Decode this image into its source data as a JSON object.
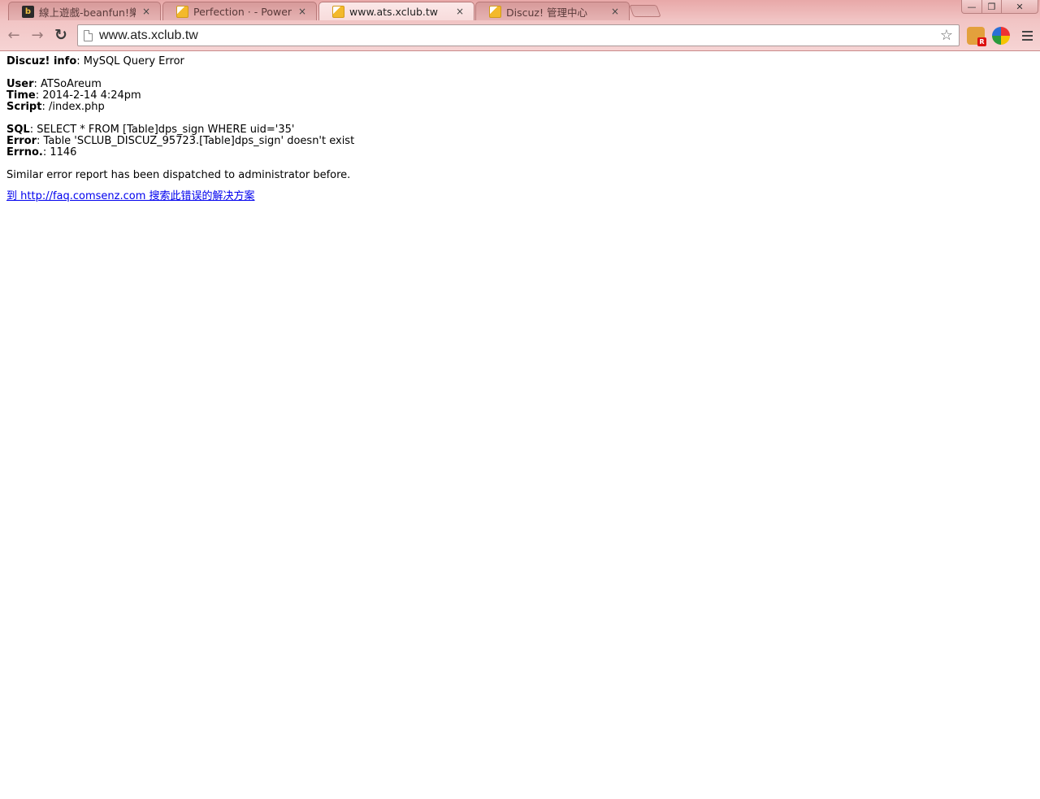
{
  "browser": {
    "tabs": [
      {
        "title": "線上遊戲-beanfun!樂豆",
        "favicon": "beanfun-icon",
        "active": false
      },
      {
        "title": "Perfection · - Powered b",
        "favicon": "discuz-icon",
        "active": false
      },
      {
        "title": "www.ats.xclub.tw",
        "favicon": "discuz-icon",
        "active": true
      },
      {
        "title": "Discuz! 管理中心",
        "favicon": "discuz-icon",
        "active": false
      }
    ],
    "tab_close_glyph": "×",
    "window_controls": {
      "minimize": "—",
      "maximize": "❐",
      "close": "✕"
    },
    "nav": {
      "back": "←",
      "forward": "→",
      "reload": "↻"
    },
    "address": {
      "url": "www.ats.xclub.tw"
    },
    "bookmark_star": "☆",
    "extensions": [
      {
        "name": "tampermonkey-icon",
        "badge": "R"
      },
      {
        "name": "chrome-extension-icon"
      }
    ]
  },
  "error_page": {
    "info": {
      "label": "Discuz! info",
      "value": ": MySQL Query Error"
    },
    "user": {
      "label": "User",
      "value": ": ATSoAreum"
    },
    "time": {
      "label": "Time",
      "value": ": 2014-2-14 4:24pm"
    },
    "script": {
      "label": "Script",
      "value": ": /index.php"
    },
    "sql": {
      "label": "SQL",
      "value": ": SELECT * FROM [Table]dps_sign WHERE uid='35'"
    },
    "error": {
      "label": "Error",
      "value": ": Table 'SCLUB_DISCUZ_95723.[Table]dps_sign' doesn't exist"
    },
    "errno": {
      "label": "Errno.",
      "value": ": 1146"
    },
    "notice": "Similar error report has been dispatched to administrator before.",
    "faq_link": "到 http://faq.comsenz.com 搜索此错误的解决方案"
  }
}
